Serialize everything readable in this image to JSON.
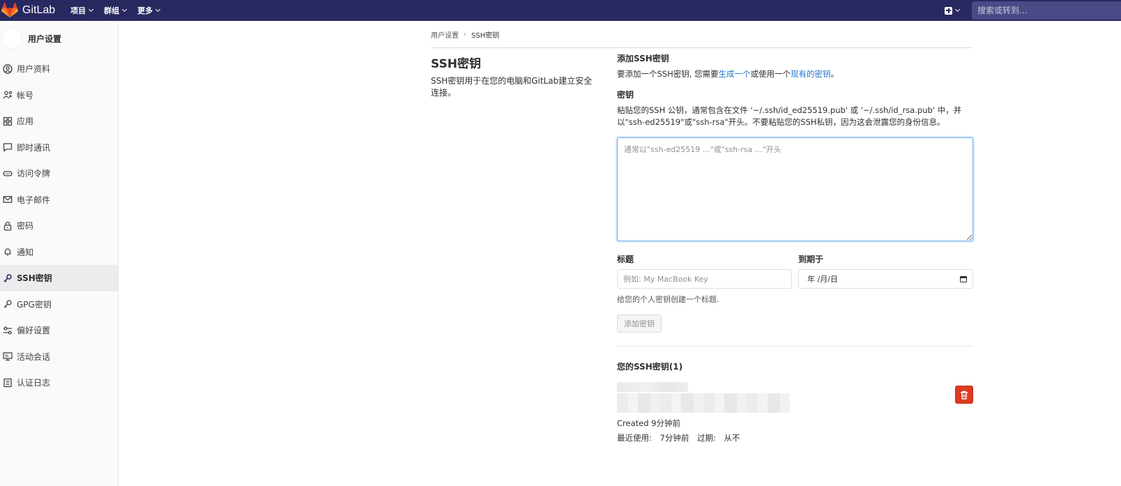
{
  "navbar": {
    "brand": "GitLab",
    "menu": [
      {
        "label": "项目"
      },
      {
        "label": "群组"
      },
      {
        "label": "更多"
      }
    ],
    "search_placeholder": "搜索或转到..."
  },
  "sidebar": {
    "title": "用户设置",
    "items": [
      {
        "label": "用户资料",
        "icon": "profile-icon"
      },
      {
        "label": "帐号",
        "icon": "account-icon"
      },
      {
        "label": "应用",
        "icon": "applications-icon"
      },
      {
        "label": "即时通讯",
        "icon": "chat-icon"
      },
      {
        "label": "访问令牌",
        "icon": "token-icon"
      },
      {
        "label": "电子邮件",
        "icon": "mail-icon"
      },
      {
        "label": "密码",
        "icon": "lock-icon"
      },
      {
        "label": "通知",
        "icon": "bell-icon"
      },
      {
        "label": "SSH密钥",
        "icon": "key-icon",
        "active": true
      },
      {
        "label": "GPG密钥",
        "icon": "key-icon"
      },
      {
        "label": "偏好设置",
        "icon": "preferences-icon"
      },
      {
        "label": "活动会话",
        "icon": "monitor-icon"
      },
      {
        "label": "认证日志",
        "icon": "log-icon"
      }
    ]
  },
  "breadcrumb": {
    "parent": "用户设置",
    "current": "SSH密钥"
  },
  "page": {
    "title": "SSH密钥",
    "description": "SSH密钥用于在您的电脑和GitLab建立安全连接。"
  },
  "add_section": {
    "heading": "添加SSH密钥",
    "intro_prefix": "要添加一个SSH密钥, 您需要",
    "intro_link1": "生成一个",
    "intro_middle": "或使用一个",
    "intro_link2": "现有的密钥",
    "intro_suffix": "。",
    "key_label": "密钥",
    "key_help": "粘贴您的SSH 公钥，通常包含在文件 '~/.ssh/id_ed25519.pub' 或 '~/.ssh/id_rsa.pub' 中，并以\"ssh-ed25519\"或\"ssh-rsa\"开头。不要粘贴您的SSH私钥，因为这会泄露您的身份信息。",
    "key_placeholder": "通常以\"ssh-ed25519 …\"或\"ssh-rsa …\"开头",
    "title_label": "标题",
    "title_placeholder": "例如: My MacBook Key",
    "expires_label": "到期于",
    "expires_value": "年 /月/日",
    "title_help": "给您的个人密钥创建一个标题.",
    "add_button": "添加密钥"
  },
  "keys_section": {
    "heading": "您的SSH密钥(1)",
    "keys": [
      {
        "created": "Created 9分钟前",
        "last_used_label": "最近使用:",
        "last_used_value": "7分钟前",
        "expires_label": "过期:",
        "expires_value": "从不"
      }
    ]
  },
  "colors": {
    "navbar": "#292961",
    "link": "#1f78d1",
    "danger": "#db3b21",
    "focus": "#73afea"
  }
}
